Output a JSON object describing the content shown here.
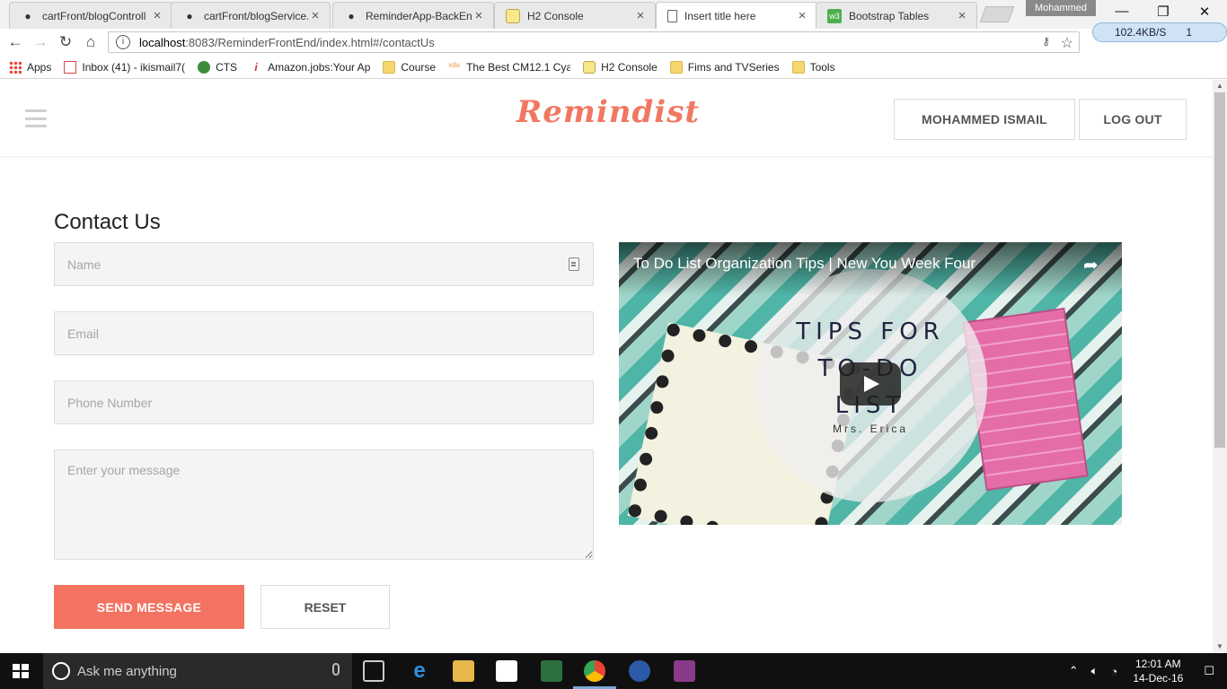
{
  "browser": {
    "tabs": [
      {
        "title": "cartFront/blogControll",
        "icon": "github-icon",
        "active": false
      },
      {
        "title": "cartFront/blogService.",
        "icon": "github-icon",
        "active": false
      },
      {
        "title": "ReminderApp-BackEn",
        "icon": "github-icon",
        "active": false
      },
      {
        "title": "H2 Console",
        "icon": "h2-icon",
        "active": false
      },
      {
        "title": "Insert title here",
        "icon": "page-icon",
        "active": true
      },
      {
        "title": "Bootstrap Tables",
        "icon": "bootstrap-icon",
        "active": false
      }
    ],
    "profile_name": "Mohammed",
    "url_host": "localhost",
    "url_rest": ":8083/ReminderFrontEnd/index.html#/contactUs",
    "net_speed": "102.4KB/S",
    "net_count": "1",
    "bookmarks": [
      {
        "label": "Apps",
        "icon": "apps-grid-icon"
      },
      {
        "label": "Inbox (41) - ikismail7(",
        "icon": "gmail-icon"
      },
      {
        "label": "CTS",
        "icon": "globe-icon"
      },
      {
        "label": "Amazon.jobs:Your Ap",
        "icon": "info-icon"
      },
      {
        "label": "Course",
        "icon": "folder-icon"
      },
      {
        "label": "The Best CM12.1 Cyar",
        "icon": "xda-icon"
      },
      {
        "label": "H2 Console",
        "icon": "h2-icon"
      },
      {
        "label": "Fims and TVSeries",
        "icon": "folder-icon"
      },
      {
        "label": "Tools",
        "icon": "folder-icon"
      }
    ]
  },
  "site": {
    "logo": "Remindist",
    "user_button": "MOHAMMED ISMAIL",
    "logout_button": "LOG OUT"
  },
  "contact": {
    "title": "Contact Us",
    "name_placeholder": "Name",
    "email_placeholder": "Email",
    "phone_placeholder": "Phone Number",
    "message_placeholder": "Enter your message",
    "send_label": "SEND MESSAGE",
    "reset_label": "RESET"
  },
  "video": {
    "title": "To Do List Organization Tips | New You Week Four",
    "overlay_line1": "TIPS FOR",
    "overlay_line2": "TO-DO",
    "overlay_line3": "LIST",
    "overlay_author": "Mrs. Erica"
  },
  "taskbar": {
    "search_placeholder": "Ask me anything",
    "time": "12:01 AM",
    "date": "14-Dec-16"
  },
  "colors": {
    "accent": "#f47262",
    "logo": "#f07862"
  }
}
